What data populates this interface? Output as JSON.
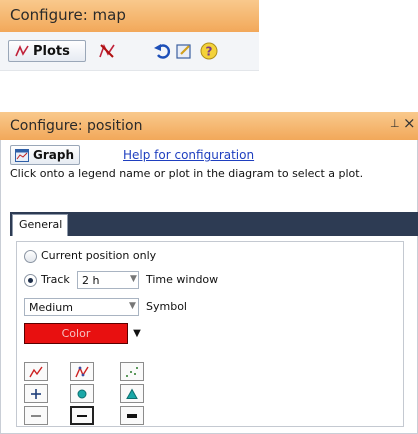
{
  "map_panel": {
    "title": "Configure: map",
    "toolbar": {
      "plots_label": "Plots",
      "icons": [
        "plots-icon",
        "remove-plot-icon",
        "undo-icon",
        "edit-icon",
        "help-icon"
      ]
    }
  },
  "position_panel": {
    "title": "Configure: position",
    "pin_glyph": "⊥",
    "close_glyph": "×",
    "graph_label": "Graph",
    "help_link": "Help for configuration",
    "instruction": "Click onto a legend name or plot in the diagram to select a plot.",
    "tabs": [
      {
        "label": "General",
        "active": true
      }
    ],
    "general": {
      "current_position_label": "Current position only",
      "track_label": "Track",
      "track_value": "2 h",
      "time_window_label": "Time window",
      "symbol_size_value": "Medium",
      "symbol_label": "Symbol",
      "color_label": "Color",
      "color_hex": "#e81010",
      "mode": "Track",
      "style_icons": [
        "line-style-icon",
        "line-markers-style-icon",
        "dots-style-icon",
        "plus-marker-icon",
        "circle-marker-icon",
        "triangle-marker-icon",
        "thin-line-icon",
        "medium-line-icon",
        "thick-line-icon"
      ]
    }
  }
}
